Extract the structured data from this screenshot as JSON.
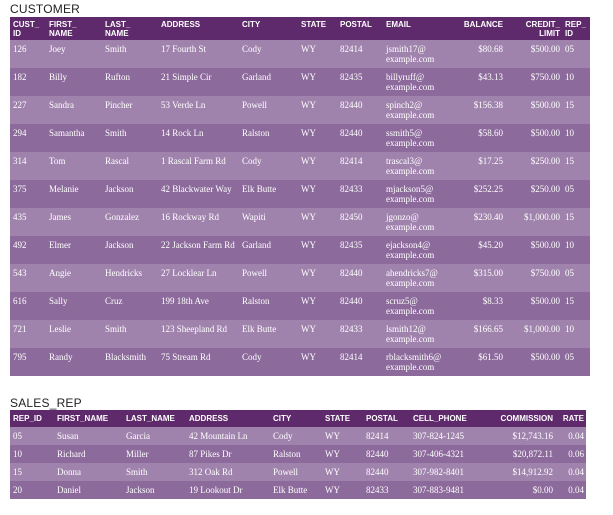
{
  "customer": {
    "caption": "CUSTOMER",
    "headers": [
      "CUST_ ID",
      "FIRST_ NAME",
      "LAST_ NAME",
      "ADDRESS",
      "CITY",
      "STATE",
      "POSTAL",
      "EMAIL",
      "BALANCE",
      "CREDIT_ LIMIT",
      "REP_ ID"
    ],
    "rows": [
      [
        "126",
        "Joey",
        "Smith",
        "17 Fourth St",
        "Cody",
        "WY",
        "82414",
        "jsmith17@ example.com",
        "$80.68",
        "$500.00",
        "05"
      ],
      [
        "182",
        "Billy",
        "Rufton",
        "21 Simple Cir",
        "Garland",
        "WY",
        "82435",
        "billyruff@ example.com",
        "$43.13",
        "$750.00",
        "10"
      ],
      [
        "227",
        "Sandra",
        "Pincher",
        "53 Verde Ln",
        "Powell",
        "WY",
        "82440",
        "spinch2@ example.com",
        "$156.38",
        "$500.00",
        "15"
      ],
      [
        "294",
        "Samantha",
        "Smith",
        "14 Rock Ln",
        "Ralston",
        "WY",
        "82440",
        "ssmith5@ example.com",
        "$58.60",
        "$500.00",
        "10"
      ],
      [
        "314",
        "Tom",
        "Rascal",
        "1 Rascal Farm Rd",
        "Cody",
        "WY",
        "82414",
        "trascal3@ example.com",
        "$17.25",
        "$250.00",
        "15"
      ],
      [
        "375",
        "Melanie",
        "Jackson",
        "42 Blackwater Way",
        "Elk Butte",
        "WY",
        "82433",
        "mjackson5@ example.com",
        "$252.25",
        "$250.00",
        "05"
      ],
      [
        "435",
        "James",
        "Gonzalez",
        "16 Rockway Rd",
        "Wapiti",
        "WY",
        "82450",
        "jgonzo@ example.com",
        "$230.40",
        "$1,000.00",
        "15"
      ],
      [
        "492",
        "Elmer",
        "Jackson",
        "22 Jackson Farm Rd",
        "Garland",
        "WY",
        "82435",
        "ejackson4@ example.com",
        "$45.20",
        "$500.00",
        "10"
      ],
      [
        "543",
        "Angie",
        "Hendricks",
        "27 Locklear Ln",
        "Powell",
        "WY",
        "82440",
        "ahendricks7@ example.com",
        "$315.00",
        "$750.00",
        "05"
      ],
      [
        "616",
        "Sally",
        "Cruz",
        "199 18th Ave",
        "Ralston",
        "WY",
        "82440",
        "scruz5@ example.com",
        "$8.33",
        "$500.00",
        "15"
      ],
      [
        "721",
        "Leslie",
        "Smith",
        "123 Sheepland Rd",
        "Elk Butte",
        "WY",
        "82433",
        "lsmith12@ example.com",
        "$166.65",
        "$1,000.00",
        "10"
      ],
      [
        "795",
        "Randy",
        "Blacksmith",
        "75 Stream Rd",
        "Cody",
        "WY",
        "82414",
        "rblacksmith6@ example.com",
        "$61.50",
        "$500.00",
        "05"
      ]
    ]
  },
  "sales_rep": {
    "caption": "SALES_REP",
    "headers": [
      "REP_ID",
      "FIRST_NAME",
      "LAST_NAME",
      "ADDRESS",
      "CITY",
      "STATE",
      "POSTAL",
      "CELL_PHONE",
      "COMMISSION",
      "RATE"
    ],
    "rows": [
      [
        "05",
        "Susan",
        "Garcia",
        "42 Mountain Ln",
        "Cody",
        "WY",
        "82414",
        "307-824-1245",
        "$12,743.16",
        "0.04"
      ],
      [
        "10",
        "Richard",
        "Miller",
        "87 Pikes Dr",
        "Ralston",
        "WY",
        "82440",
        "307-406-4321",
        "$20,872.11",
        "0.06"
      ],
      [
        "15",
        "Donna",
        "Smith",
        "312 Oak Rd",
        "Powell",
        "WY",
        "82440",
        "307-982-8401",
        "$14,912.92",
        "0.04"
      ],
      [
        "20",
        "Daniel",
        "Jackson",
        "19 Lookout Dr",
        "Elk Butte",
        "WY",
        "82433",
        "307-883-9481",
        "$0.00",
        "0.04"
      ]
    ]
  }
}
